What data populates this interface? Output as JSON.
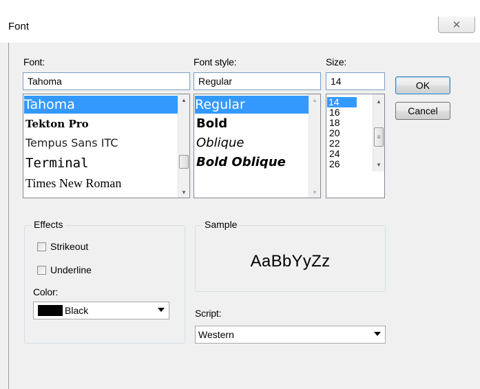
{
  "dialog": {
    "title": "Font",
    "close_glyph": "✕"
  },
  "font": {
    "label": "Font:",
    "value": "Tahoma",
    "items": [
      {
        "label": "Tahoma",
        "selected": true
      },
      {
        "label": "Tekton Pro",
        "selected": false
      },
      {
        "label": "Tempus Sans ITC",
        "selected": false
      },
      {
        "label": "Terminal",
        "selected": false
      },
      {
        "label": "Times New Roman",
        "selected": false
      }
    ]
  },
  "style": {
    "label": "Font style:",
    "value": "Regular",
    "items": [
      {
        "label": "Regular",
        "selected": true
      },
      {
        "label": "Bold",
        "selected": false
      },
      {
        "label": "Oblique",
        "selected": false
      },
      {
        "label": "Bold Oblique",
        "selected": false
      }
    ]
  },
  "size": {
    "label": "Size:",
    "value": "14",
    "items": [
      {
        "label": "14",
        "selected": true
      },
      {
        "label": "16",
        "selected": false
      },
      {
        "label": "18",
        "selected": false
      },
      {
        "label": "20",
        "selected": false
      },
      {
        "label": "22",
        "selected": false
      },
      {
        "label": "24",
        "selected": false
      },
      {
        "label": "26",
        "selected": false
      }
    ]
  },
  "buttons": {
    "ok": "OK",
    "cancel": "Cancel"
  },
  "effects": {
    "legend": "Effects",
    "strikeout": {
      "label": "Strikeout",
      "checked": false
    },
    "underline": {
      "label": "Underline",
      "checked": false
    },
    "color_label": "Color:",
    "color_value": "Black",
    "color_swatch": "#000000"
  },
  "sample": {
    "legend": "Sample",
    "text": "AaBbYyZz"
  },
  "script": {
    "label": "Script:",
    "value": "Western"
  },
  "colors": {
    "selection": "#3399ff",
    "dialog_bg": "#f0f0f0"
  }
}
